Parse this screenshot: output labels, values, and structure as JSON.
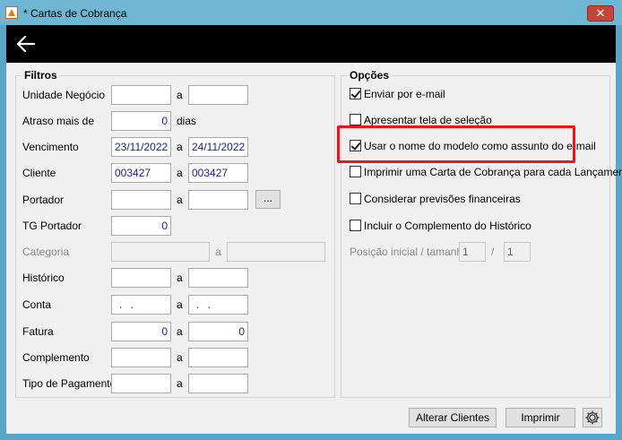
{
  "window": {
    "title": "* Cartas de Cobrança",
    "close_glyph": "✕"
  },
  "filtros": {
    "title": "Filtros",
    "separator": "a",
    "unidade_negocio": {
      "label": "Unidade Negócio",
      "from": "",
      "to": ""
    },
    "atraso": {
      "label": "Atraso mais de",
      "value": "0",
      "unit": "dias"
    },
    "vencimento": {
      "label": "Vencimento",
      "from": "23/11/2022",
      "to": "24/11/2022"
    },
    "cliente": {
      "label": "Cliente",
      "from": "003427",
      "to": "003427"
    },
    "portador": {
      "label": "Portador",
      "from": "",
      "to": "",
      "browse_label": "..."
    },
    "tg_portador": {
      "label": "TG Portador",
      "value": "0"
    },
    "categoria": {
      "label": "Categoria",
      "from": "",
      "to": ""
    },
    "historico": {
      "label": "Histórico",
      "from": "",
      "to": ""
    },
    "conta": {
      "label": "Conta",
      "from": ". .",
      "to": ". ."
    },
    "fatura": {
      "label": "Fatura",
      "from": "0",
      "to": "0"
    },
    "complemento": {
      "label": "Complemento",
      "from": "",
      "to": ""
    },
    "tipo_pagamento": {
      "label": "Tipo de Pagamento",
      "from": "",
      "to": ""
    }
  },
  "opcoes": {
    "title": "Opções",
    "options": [
      {
        "label": "Enviar por e-mail",
        "checked": true
      },
      {
        "label": "Apresentar tela de seleção",
        "checked": false
      },
      {
        "label": "Usar o nome do modelo como assunto do e-mail",
        "checked": true
      },
      {
        "label": "Imprimir uma Carta de Cobrança para cada Lançamento",
        "checked": false
      },
      {
        "label": "Considerar previsões financeiras",
        "checked": false
      },
      {
        "label": "Incluir o Complemento do Histórico",
        "checked": false
      }
    ],
    "posicao": {
      "label": "Posição inicial / tamanho",
      "start": "1",
      "separator": "/",
      "size": "1"
    }
  },
  "buttons": {
    "alterar_clientes": "Alterar Clientes",
    "imprimir": "Imprimir"
  },
  "colors": {
    "highlight": "#e8141a",
    "toolbar": "#000000",
    "input_text": "#1a237e"
  }
}
